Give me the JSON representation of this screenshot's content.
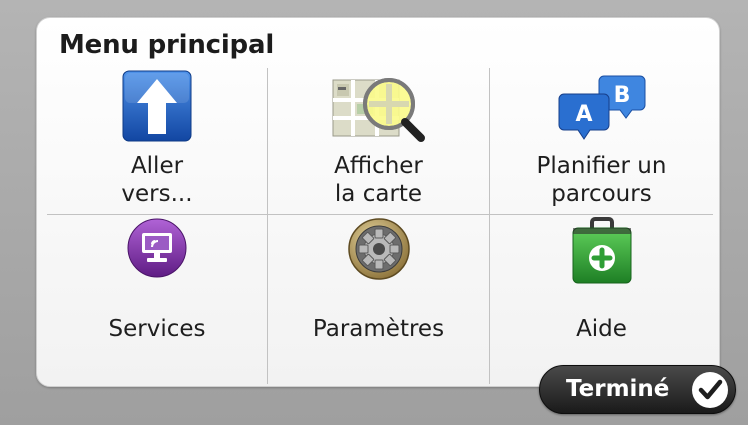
{
  "menu": {
    "title": "Menu principal",
    "items": [
      {
        "label": "Aller\nvers...",
        "icon": "up-arrow-icon"
      },
      {
        "label": "Afficher\nla carte",
        "icon": "map-magnifier-icon"
      },
      {
        "label": "Planifier un\nparcours",
        "icon": "route-ab-icon"
      },
      {
        "label": "Services",
        "icon": "services-monitor-icon"
      },
      {
        "label": "Paramètres",
        "icon": "gear-icon"
      },
      {
        "label": "Aide",
        "icon": "first-aid-kit-icon"
      }
    ]
  },
  "done_button": {
    "label": "Terminé",
    "icon": "checkmark-icon"
  },
  "colors": {
    "blue": "#1f64c4",
    "purple": "#7a2f9e",
    "green": "#2e9e35",
    "dark_button": "#222222"
  }
}
